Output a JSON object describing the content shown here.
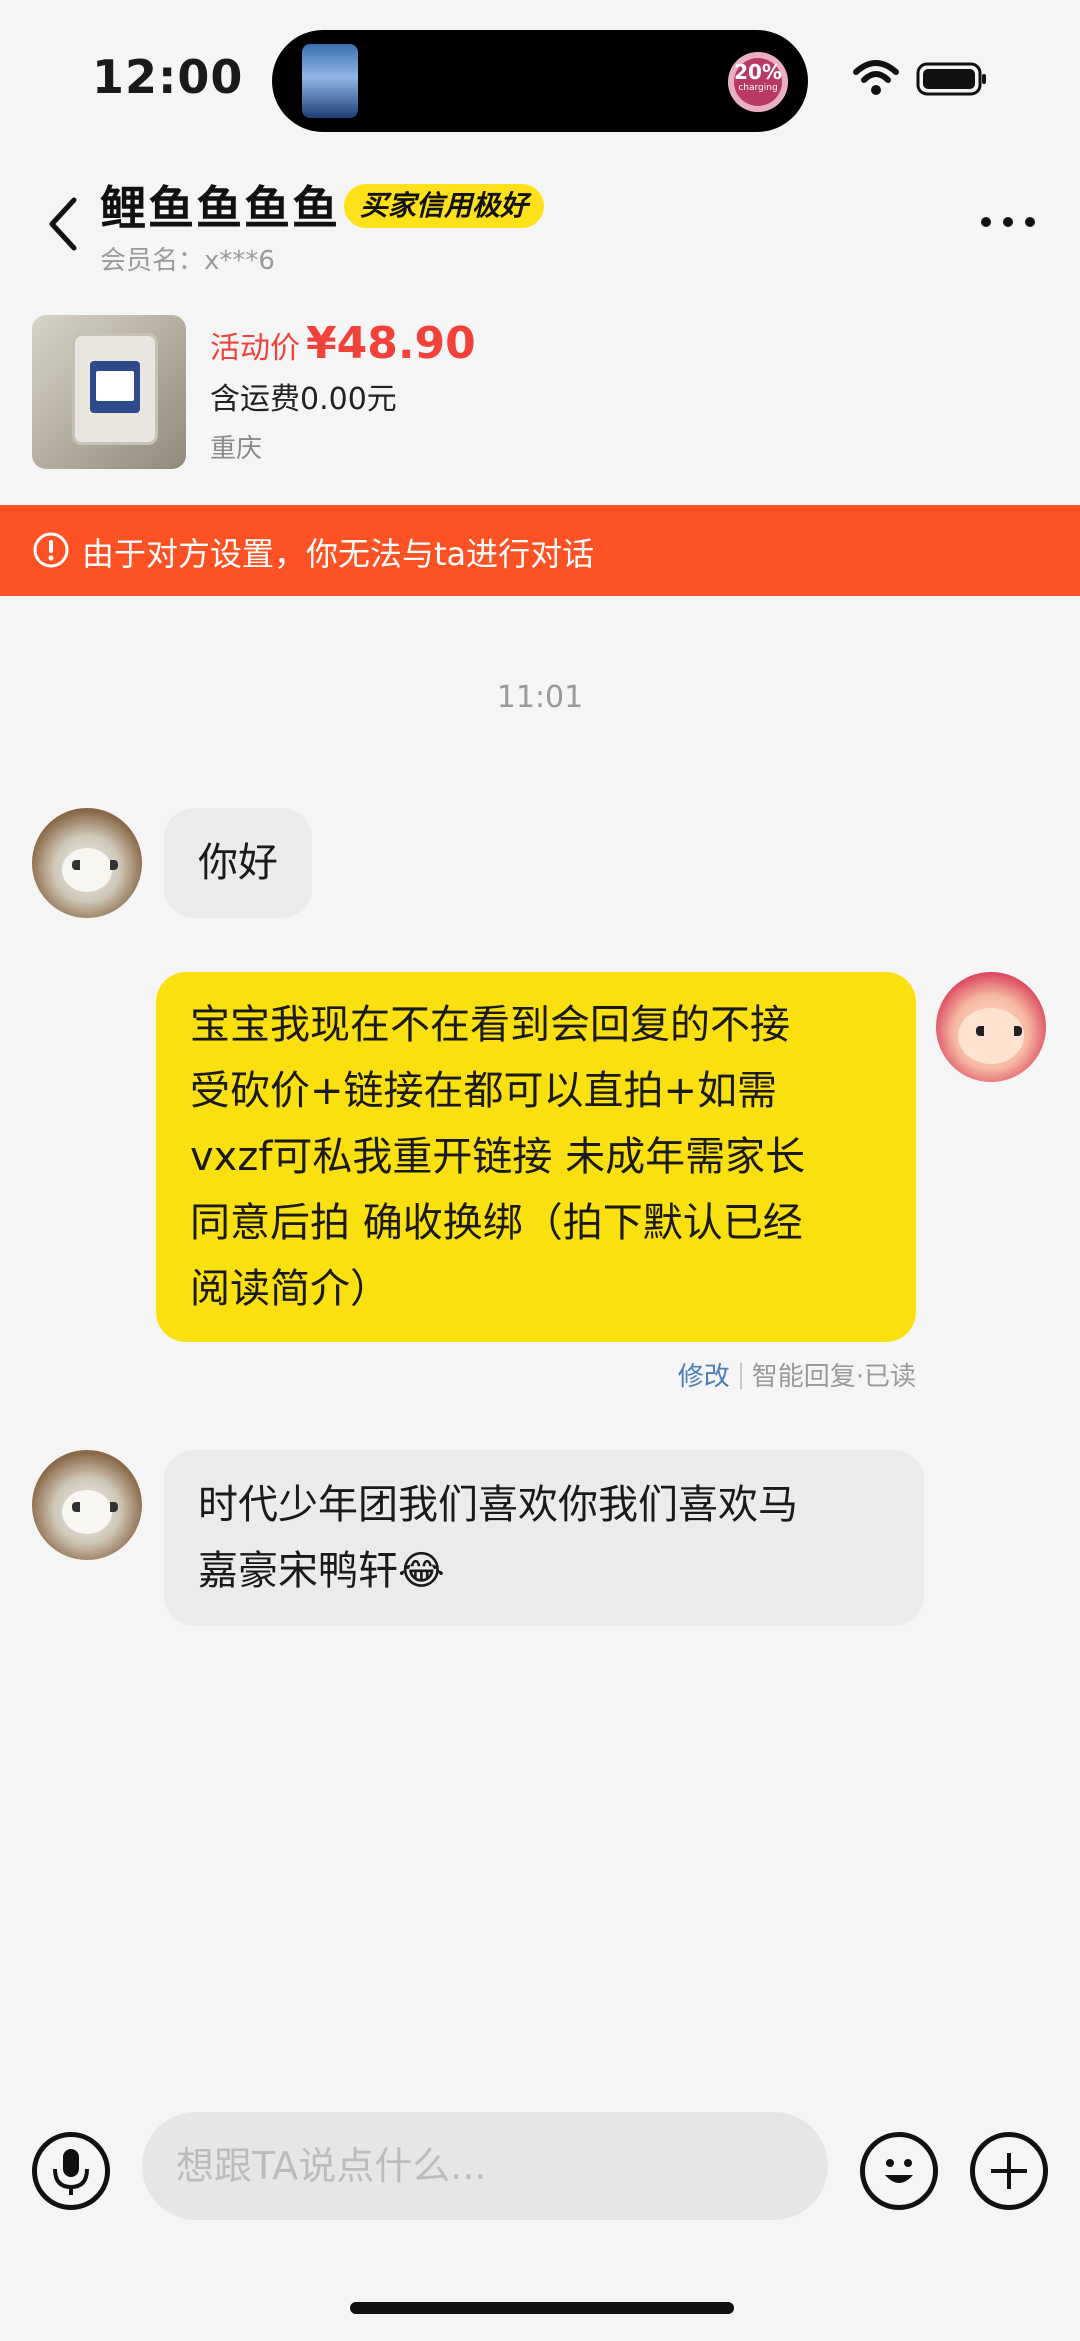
{
  "status_bar": {
    "time": "12:00",
    "charge_percent": "20%",
    "charge_label": "charging",
    "icons": [
      "wifi-icon",
      "battery-icon"
    ]
  },
  "header": {
    "seller_name": "鲤鱼鱼鱼鱼",
    "credit_badge": "买家信用极好",
    "member_id": "会员名：x***6",
    "icons": [
      "back-icon",
      "more-icon"
    ]
  },
  "product": {
    "price_label": "活动价",
    "price": "¥48.90",
    "shipping": "含运费0.00元",
    "location": "重庆"
  },
  "warning": {
    "text": "由于对方设置，你无法与ta进行对话",
    "icon": "alert-circle-icon",
    "color": "#ff5224"
  },
  "chat": {
    "timestamp": "11:01",
    "messages": [
      {
        "side": "in",
        "text": "你好"
      },
      {
        "side": "out",
        "lines": [
          "宝宝我现在不在看到会回复的不接",
          "受砍价+链接在都可以直拍+如需",
          "vxzf可私我重开链接 未成年需家长",
          "同意后拍 确收换绑（拍下默认已经",
          "阅读简介）"
        ]
      },
      {
        "side": "in",
        "lines": [
          "时代少年团我们喜欢你我们喜欢马",
          "嘉豪宋鸭轩😂"
        ]
      }
    ],
    "reply_meta": {
      "edit": "修改",
      "status": "智能回复·已读"
    }
  },
  "input": {
    "placeholder": "想跟TA说点什么...",
    "icons": [
      "mic-icon",
      "emoji-icon",
      "plus-icon"
    ]
  },
  "colors": {
    "accent_yellow": "#fbe010",
    "price_red": "#f0423a",
    "warning_orange": "#ff5224"
  }
}
